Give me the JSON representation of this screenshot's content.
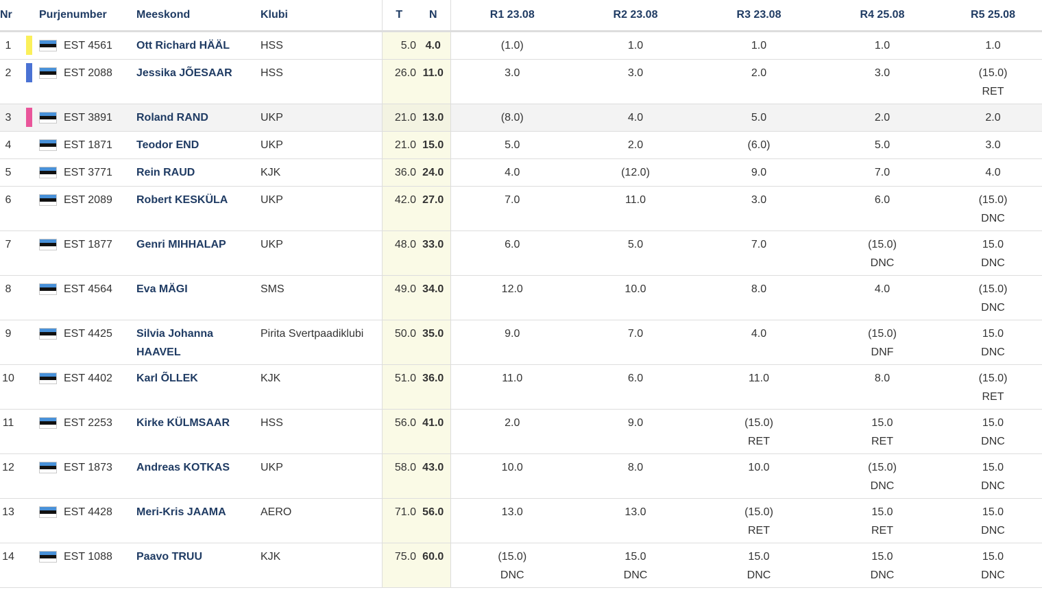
{
  "headers": {
    "nr": "Nr",
    "sail": "Purjenumber",
    "crew": "Meeskond",
    "club": "Klubi",
    "total": "T",
    "net": "N",
    "races": [
      "R1 23.08",
      "R2 23.08",
      "R3 23.08",
      "R4 25.08",
      "R5 25.08"
    ]
  },
  "colors": {
    "gold": "#fbf05a",
    "silver": "#4a72d4",
    "bronze": "#e9559a",
    "crew_text": "#1f3b63",
    "score_bg": "#fafae6"
  },
  "flag_icon": "estonia-flag-icon",
  "rows": [
    {
      "nr": "1",
      "sail": "EST 4561",
      "crew": "Ott Richard HÄÄL",
      "club": "HSS",
      "total": "5.0",
      "net": "4.0",
      "races": [
        {
          "s": "(1.0)",
          "c": ""
        },
        {
          "s": "1.0",
          "c": ""
        },
        {
          "s": "1.0",
          "c": ""
        },
        {
          "s": "1.0",
          "c": ""
        },
        {
          "s": "1.0",
          "c": ""
        }
      ]
    },
    {
      "nr": "2",
      "sail": "EST 2088",
      "crew": "Jessika JÕESAAR",
      "club": "HSS",
      "total": "26.0",
      "net": "11.0",
      "races": [
        {
          "s": "3.0",
          "c": ""
        },
        {
          "s": "3.0",
          "c": ""
        },
        {
          "s": "2.0",
          "c": ""
        },
        {
          "s": "3.0",
          "c": ""
        },
        {
          "s": "(15.0)",
          "c": "RET"
        }
      ]
    },
    {
      "nr": "3",
      "sail": "EST 3891",
      "crew": "Roland RAND",
      "club": "UKP",
      "total": "21.0",
      "net": "13.0",
      "races": [
        {
          "s": "(8.0)",
          "c": ""
        },
        {
          "s": "4.0",
          "c": ""
        },
        {
          "s": "5.0",
          "c": ""
        },
        {
          "s": "2.0",
          "c": ""
        },
        {
          "s": "2.0",
          "c": ""
        }
      ]
    },
    {
      "nr": "4",
      "sail": "EST 1871",
      "crew": "Teodor END",
      "club": "UKP",
      "total": "21.0",
      "net": "15.0",
      "races": [
        {
          "s": "5.0",
          "c": ""
        },
        {
          "s": "2.0",
          "c": ""
        },
        {
          "s": "(6.0)",
          "c": ""
        },
        {
          "s": "5.0",
          "c": ""
        },
        {
          "s": "3.0",
          "c": ""
        }
      ]
    },
    {
      "nr": "5",
      "sail": "EST 3771",
      "crew": "Rein RAUD",
      "club": "KJK",
      "total": "36.0",
      "net": "24.0",
      "races": [
        {
          "s": "4.0",
          "c": ""
        },
        {
          "s": "(12.0)",
          "c": ""
        },
        {
          "s": "9.0",
          "c": ""
        },
        {
          "s": "7.0",
          "c": ""
        },
        {
          "s": "4.0",
          "c": ""
        }
      ]
    },
    {
      "nr": "6",
      "sail": "EST 2089",
      "crew": "Robert KESKÜLA",
      "club": "UKP",
      "total": "42.0",
      "net": "27.0",
      "races": [
        {
          "s": "7.0",
          "c": ""
        },
        {
          "s": "11.0",
          "c": ""
        },
        {
          "s": "3.0",
          "c": ""
        },
        {
          "s": "6.0",
          "c": ""
        },
        {
          "s": "(15.0)",
          "c": "DNC"
        }
      ]
    },
    {
      "nr": "7",
      "sail": "EST 1877",
      "crew": "Genri MIHHALAP",
      "club": "UKP",
      "total": "48.0",
      "net": "33.0",
      "races": [
        {
          "s": "6.0",
          "c": ""
        },
        {
          "s": "5.0",
          "c": ""
        },
        {
          "s": "7.0",
          "c": ""
        },
        {
          "s": "(15.0)",
          "c": "DNC"
        },
        {
          "s": "15.0",
          "c": "DNC"
        }
      ]
    },
    {
      "nr": "8",
      "sail": "EST 4564",
      "crew": "Eva MÄGI",
      "club": "SMS",
      "total": "49.0",
      "net": "34.0",
      "races": [
        {
          "s": "12.0",
          "c": ""
        },
        {
          "s": "10.0",
          "c": ""
        },
        {
          "s": "8.0",
          "c": ""
        },
        {
          "s": "4.0",
          "c": ""
        },
        {
          "s": "(15.0)",
          "c": "DNC"
        }
      ]
    },
    {
      "nr": "9",
      "sail": "EST 4425",
      "crew": "Silvia Johanna HAAVEL",
      "club": "Pirita Svertpaadiklubi",
      "total": "50.0",
      "net": "35.0",
      "races": [
        {
          "s": "9.0",
          "c": ""
        },
        {
          "s": "7.0",
          "c": ""
        },
        {
          "s": "4.0",
          "c": ""
        },
        {
          "s": "(15.0)",
          "c": "DNF"
        },
        {
          "s": "15.0",
          "c": "DNC"
        }
      ]
    },
    {
      "nr": "10",
      "sail": "EST 4402",
      "crew": "Karl ÕLLEK",
      "club": "KJK",
      "total": "51.0",
      "net": "36.0",
      "races": [
        {
          "s": "11.0",
          "c": ""
        },
        {
          "s": "6.0",
          "c": ""
        },
        {
          "s": "11.0",
          "c": ""
        },
        {
          "s": "8.0",
          "c": ""
        },
        {
          "s": "(15.0)",
          "c": "RET"
        }
      ]
    },
    {
      "nr": "11",
      "sail": "EST 2253",
      "crew": "Kirke KÜLMSAAR",
      "club": "HSS",
      "total": "56.0",
      "net": "41.0",
      "races": [
        {
          "s": "2.0",
          "c": ""
        },
        {
          "s": "9.0",
          "c": ""
        },
        {
          "s": "(15.0)",
          "c": "RET"
        },
        {
          "s": "15.0",
          "c": "RET"
        },
        {
          "s": "15.0",
          "c": "DNC"
        }
      ]
    },
    {
      "nr": "12",
      "sail": "EST 1873",
      "crew": "Andreas KOTKAS",
      "club": "UKP",
      "total": "58.0",
      "net": "43.0",
      "races": [
        {
          "s": "10.0",
          "c": ""
        },
        {
          "s": "8.0",
          "c": ""
        },
        {
          "s": "10.0",
          "c": ""
        },
        {
          "s": "(15.0)",
          "c": "DNC"
        },
        {
          "s": "15.0",
          "c": "DNC"
        }
      ]
    },
    {
      "nr": "13",
      "sail": "EST 4428",
      "crew": "Meri-Kris JAAMA",
      "club": "AERO",
      "total": "71.0",
      "net": "56.0",
      "races": [
        {
          "s": "13.0",
          "c": ""
        },
        {
          "s": "13.0",
          "c": ""
        },
        {
          "s": "(15.0)",
          "c": "RET"
        },
        {
          "s": "15.0",
          "c": "RET"
        },
        {
          "s": "15.0",
          "c": "DNC"
        }
      ]
    },
    {
      "nr": "14",
      "sail": "EST 1088",
      "crew": "Paavo TRUU",
      "club": "KJK",
      "total": "75.0",
      "net": "60.0",
      "races": [
        {
          "s": "(15.0)",
          "c": "DNC"
        },
        {
          "s": "15.0",
          "c": "DNC"
        },
        {
          "s": "15.0",
          "c": "DNC"
        },
        {
          "s": "15.0",
          "c": "DNC"
        },
        {
          "s": "15.0",
          "c": "DNC"
        }
      ]
    }
  ]
}
